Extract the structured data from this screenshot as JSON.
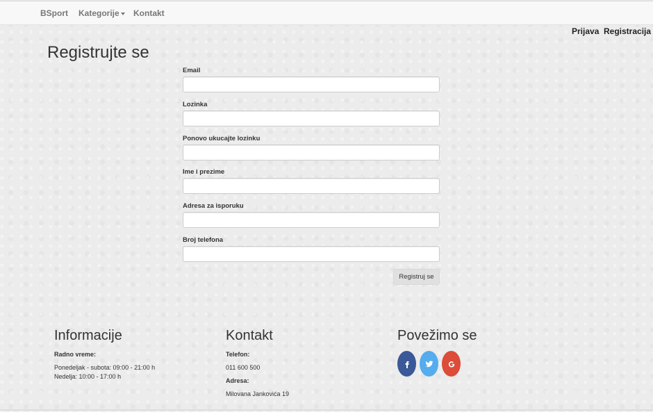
{
  "navbar": {
    "brand": "BSport",
    "items": [
      {
        "label": "Kategorije"
      },
      {
        "label": "Kontakt"
      }
    ]
  },
  "auth": {
    "login": "Prijava",
    "register": "Registracija"
  },
  "page": {
    "title": "Registrujte se"
  },
  "form": {
    "fields": [
      {
        "label": "Email",
        "value": ""
      },
      {
        "label": "Lozinka",
        "value": ""
      },
      {
        "label": "Ponovo ukucajte lozinku",
        "value": ""
      },
      {
        "label": "Ime i prezime",
        "value": ""
      },
      {
        "label": "Adresa za isporuku",
        "value": ""
      },
      {
        "label": "Broj telefona",
        "value": ""
      }
    ],
    "submit_label": "Registruj se"
  },
  "footer": {
    "info": {
      "title": "Informacije",
      "hours_label": "Radno vreme:",
      "weekdays": "Ponedeljak - subota: 09:00 - 21:00 h",
      "sunday": "Nedelja: 10:00 - 17:00 h"
    },
    "contact": {
      "title": "Kontakt",
      "phone_label": "Telefon:",
      "phone": "011 600 500",
      "address_label": "Adresa:",
      "address": "Milovana Jankovića 19"
    },
    "social": {
      "title": "Povežimo se",
      "links": [
        {
          "icon": "facebook-icon",
          "color": "#3b5998"
        },
        {
          "icon": "twitter-icon",
          "color": "#55acee"
        },
        {
          "icon": "google-plus-icon",
          "color": "#dd4b39"
        }
      ]
    }
  }
}
